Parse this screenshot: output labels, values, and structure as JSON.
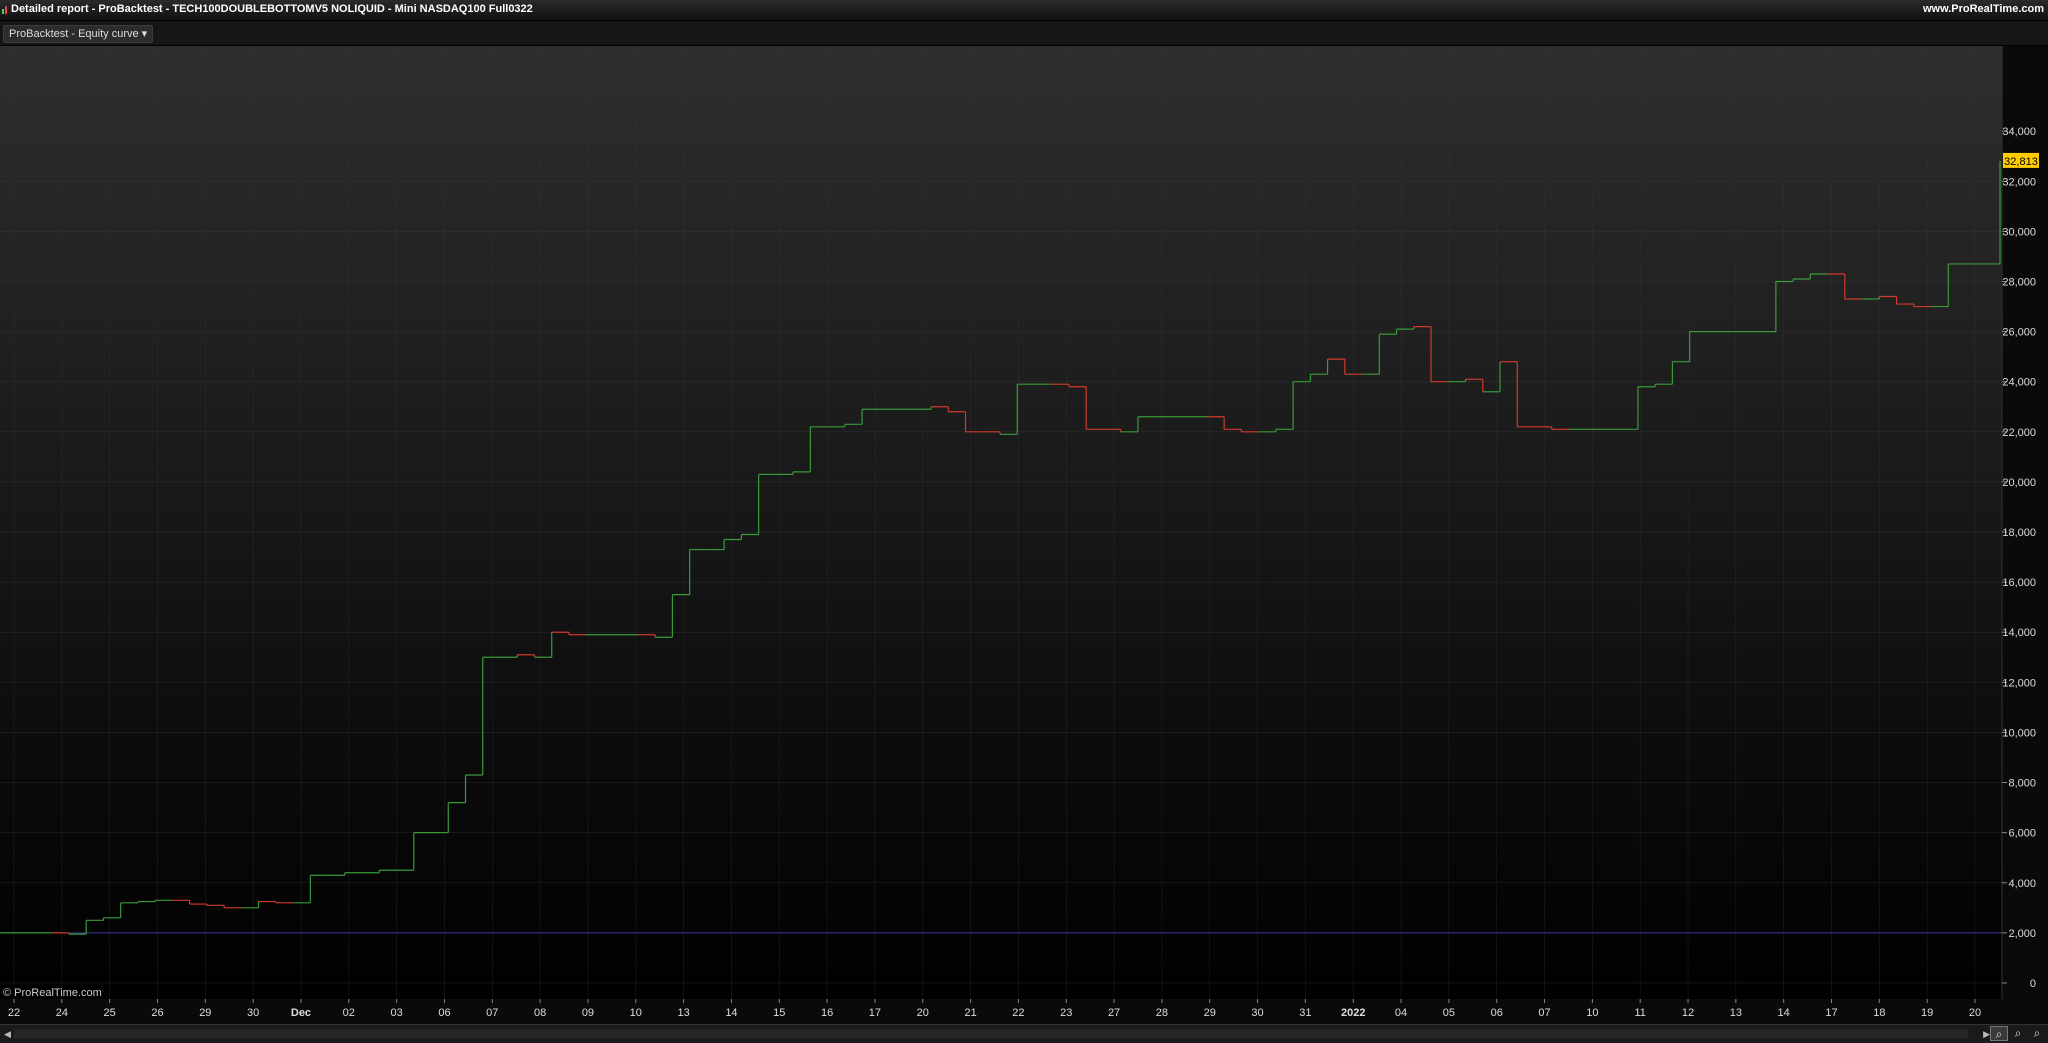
{
  "window": {
    "title": "Detailed report - ProBacktest - TECH100DOUBLEBOTTOMV5 NOLIQUID - Mini NASDAQ100 Full0322",
    "website": "www.ProRealTime.com"
  },
  "toolbar": {
    "chart_selector": "ProBacktest - Equity curve ▾"
  },
  "colors": {
    "up": "#3a9a3a",
    "down": "#d03a2c",
    "baseline": "#3a3a9a",
    "last_value_bg": "#ffcc00",
    "background_top": "#2e2e2e",
    "background_bottom": "#000000"
  },
  "icons": {
    "scroll_left": "triangle-left-icon",
    "scroll_right": "triangle-right-icon",
    "zoom": [
      "zoom-reset-icon",
      "zoom-out-icon",
      "zoom-in-icon"
    ]
  },
  "copyright": "© ProRealTime.com",
  "chart_data": {
    "type": "line",
    "title": "",
    "xlabel": "",
    "ylabel": "",
    "grid": true,
    "y_ticks": [
      "34,000",
      "32,000",
      "30,000",
      "28,000",
      "26,000",
      "24,000",
      "22,000",
      "20,000",
      "18,000",
      "16,000",
      "14,000",
      "12,000",
      "10,000",
      "8,000",
      "6,000",
      "4,000",
      "2,000",
      "0"
    ],
    "ylim": [
      -600,
      37400
    ],
    "x_tick_labels": [
      "22",
      "24",
      "25",
      "26",
      "29",
      "30",
      "Dec",
      "02",
      "03",
      "06",
      "07",
      "08",
      "09",
      "10",
      "13",
      "14",
      "15",
      "16",
      "17",
      "20",
      "21",
      "22",
      "23",
      "27",
      "28",
      "29",
      "30",
      "31",
      "2022",
      "04",
      "05",
      "06",
      "07",
      "10",
      "11",
      "12",
      "13",
      "14",
      "17",
      "18",
      "19",
      "20"
    ],
    "last_value": 32813,
    "last_value_label": "32,813",
    "baseline_value": 2000,
    "series": [
      {
        "values": [
          2000,
          2000,
          2000,
          2000,
          1950,
          2500,
          2600,
          3200,
          3250,
          3300,
          3300,
          3150,
          3100,
          3000,
          3000,
          3250,
          3200,
          3200,
          4300,
          4300,
          4400,
          4400,
          4500,
          4500,
          6000,
          6000,
          7200,
          8300,
          13000,
          13000,
          13100,
          13000,
          14000,
          13900,
          13900,
          13900,
          13900,
          13900,
          13800,
          15500,
          17300,
          17300,
          17700,
          17900,
          20300,
          20300,
          20400,
          22200,
          22200,
          22300,
          22900,
          22900,
          22900,
          22900,
          23000,
          22800,
          22000,
          22000,
          21900,
          23900,
          23900,
          23900,
          23800,
          22100,
          22100,
          22000,
          22600,
          22600,
          22600,
          22600,
          22600,
          22100,
          22000,
          22000,
          22100,
          24000,
          24300,
          24900,
          24300,
          24300,
          25900,
          26100,
          26200,
          24000,
          24000,
          24100,
          23600,
          24800,
          22200,
          22200,
          22100,
          22100,
          22100,
          22100,
          22100,
          23800,
          23900,
          24800,
          26000,
          26000,
          26000,
          26000,
          26000,
          28000,
          28100,
          28300,
          28300,
          27300,
          27300,
          27400,
          27100,
          27000,
          27000,
          28700,
          28700,
          28700,
          32813
        ]
      }
    ]
  }
}
